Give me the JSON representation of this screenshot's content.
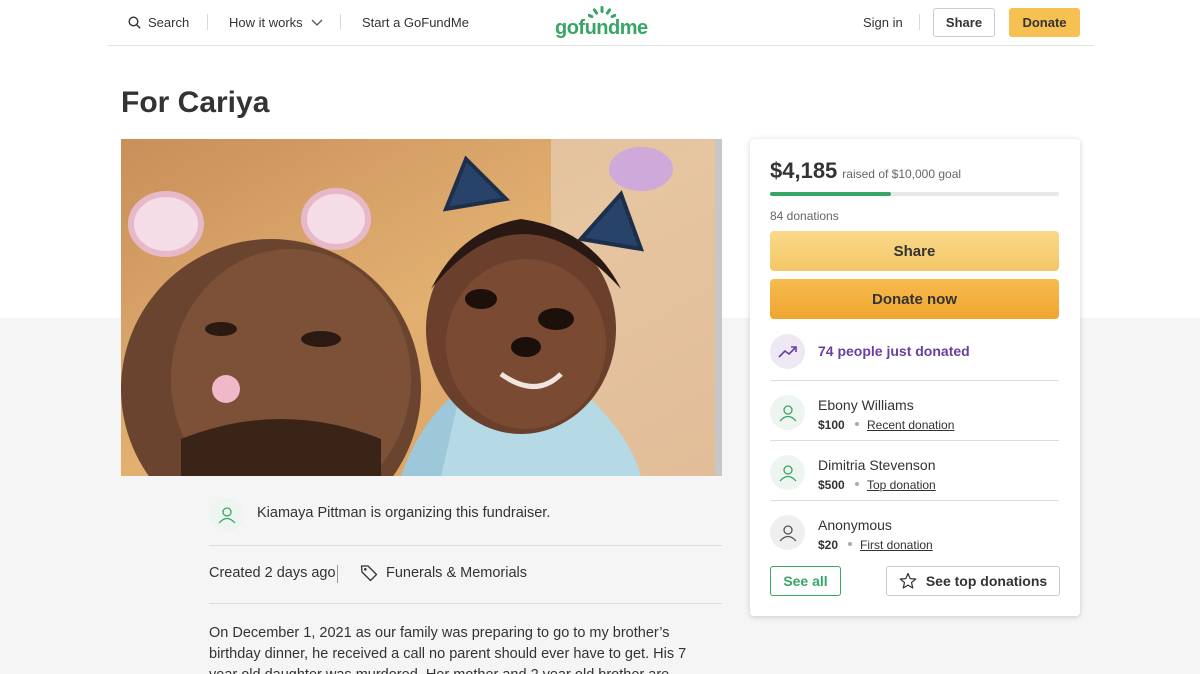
{
  "header": {
    "search_label": "Search",
    "how_label": "How it works",
    "start_label": "Start a GoFundMe",
    "logo_text": "gofundme",
    "signin_label": "Sign in",
    "share_label": "Share",
    "donate_label": "Donate"
  },
  "campaign": {
    "title": "For Cariya",
    "organizer_text": "Kiamaya Pittman is organizing this fundraiser.",
    "created": "Created 2 days ago",
    "category": "Funerals & Memorials",
    "story": "On December 1, 2021 as our family was preparing to go to my brother’s birthday dinner, he received a call no parent should ever have to get. His 7 year old daughter was murdered. Her mother and 2 year old brother are clinging to life. My sweet"
  },
  "card": {
    "raised_amount": "$4,185",
    "raised_of": "raised of $10,000 goal",
    "progress_fraction": 0.4185,
    "donation_count": "84 donations",
    "share_label": "Share",
    "donate_label": "Donate now",
    "trend_text": "74 people just donated",
    "donors": [
      {
        "name": "Ebony Williams",
        "amount": "$100",
        "label": "Recent donation"
      },
      {
        "name": "Dimitria Stevenson",
        "amount": "$500",
        "label": "Top donation"
      },
      {
        "name": "Anonymous",
        "amount": "$20",
        "label": "First donation"
      }
    ],
    "see_all_label": "See all",
    "see_top_label": "See top donations"
  },
  "colors": {
    "brand_green": "#37a664",
    "donate_yellow": "#f6c152",
    "trend_purple": "#6a3ea1"
  }
}
